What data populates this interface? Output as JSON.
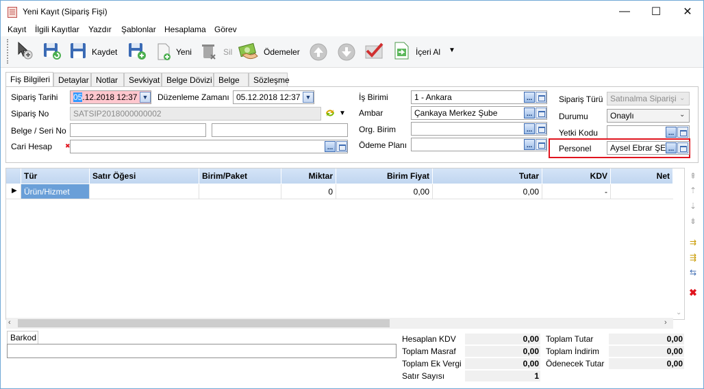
{
  "window": {
    "title": "Yeni Kayıt (Sipariş Fişi)",
    "minimize": "—",
    "maximize": "☐",
    "close": "✕"
  },
  "menu": [
    "Kayıt",
    "İlgili Kayıtlar",
    "Yazdır",
    "Şablonlar",
    "Hesaplama",
    "Görev"
  ],
  "toolbar": {
    "kaydet": "Kaydet",
    "yeni": "Yeni",
    "sil": "Sil",
    "odemeler": "Ödemeler",
    "iceri_al": "İçeri Al"
  },
  "tabs": [
    "Fiş Bilgileri",
    "Detaylar",
    "Notlar",
    "Sevkiyat",
    "Belge Dövizi",
    "Belge",
    "Sözleşme"
  ],
  "form": {
    "siparis_tarihi_label": "Sipariş Tarihi",
    "siparis_tarihi_sel": "05",
    "siparis_tarihi_rest": ".12.2018 12:37",
    "duzenleme_label": "Düzenleme Zamanı",
    "duzenleme_value": "05.12.2018 12:37",
    "siparis_no_label": "Sipariş No",
    "siparis_no_value": "SATSIP2018000000002",
    "belge_label": "Belge / Seri No",
    "cari_label": "Cari Hesap",
    "is_birimi_label": "İş Birimi",
    "is_birimi_value": "1 - Ankara",
    "ambar_label": "Ambar",
    "ambar_value": "Çankaya Merkez Şube",
    "org_birim_label": "Org. Birim",
    "odeme_plani_label": "Ödeme Planı",
    "siparis_turu_label": "Sipariş Türü",
    "siparis_turu_value": "Satınalma Siparişi",
    "durumu_label": "Durumu",
    "durumu_value": "Onaylı",
    "yetki_label": "Yetki Kodu",
    "personel_label": "Personel",
    "personel_value": "Aysel Ebrar ŞEN"
  },
  "grid": {
    "headers": [
      "Tür",
      "Satır Öğesi",
      "Birim/Paket",
      "Miktar",
      "Birim Fiyat",
      "Tutar",
      "KDV",
      "Net"
    ],
    "row": [
      "Ürün/Hizmet",
      "",
      "",
      "0",
      "0,00",
      "0,00",
      "-",
      ""
    ]
  },
  "bottom": {
    "barkod_tab": "Barkod",
    "hesaplan_kdv_label": "Hesaplan KDV",
    "hesaplan_kdv": "0,00",
    "toplam_masraf_label": "Toplam Masraf",
    "toplam_masraf": "0,00",
    "toplam_ek_vergi_label": "Toplam Ek Vergi",
    "toplam_ek_vergi": "0,00",
    "satir_sayisi_label": "Satır Sayısı",
    "satir_sayisi": "1",
    "toplam_tutar_label": "Toplam Tutar",
    "toplam_tutar": "0,00",
    "toplam_indirim_label": "Toplam İndirim",
    "toplam_indirim": "0,00",
    "odenecek_tutar_label": "Ödenecek Tutar",
    "odenecek_tutar": "0,00"
  },
  "colors": {
    "highlight": "#e0141e",
    "grid_header": "#c1d6f0",
    "selected_cell": "#6a9fd8"
  }
}
